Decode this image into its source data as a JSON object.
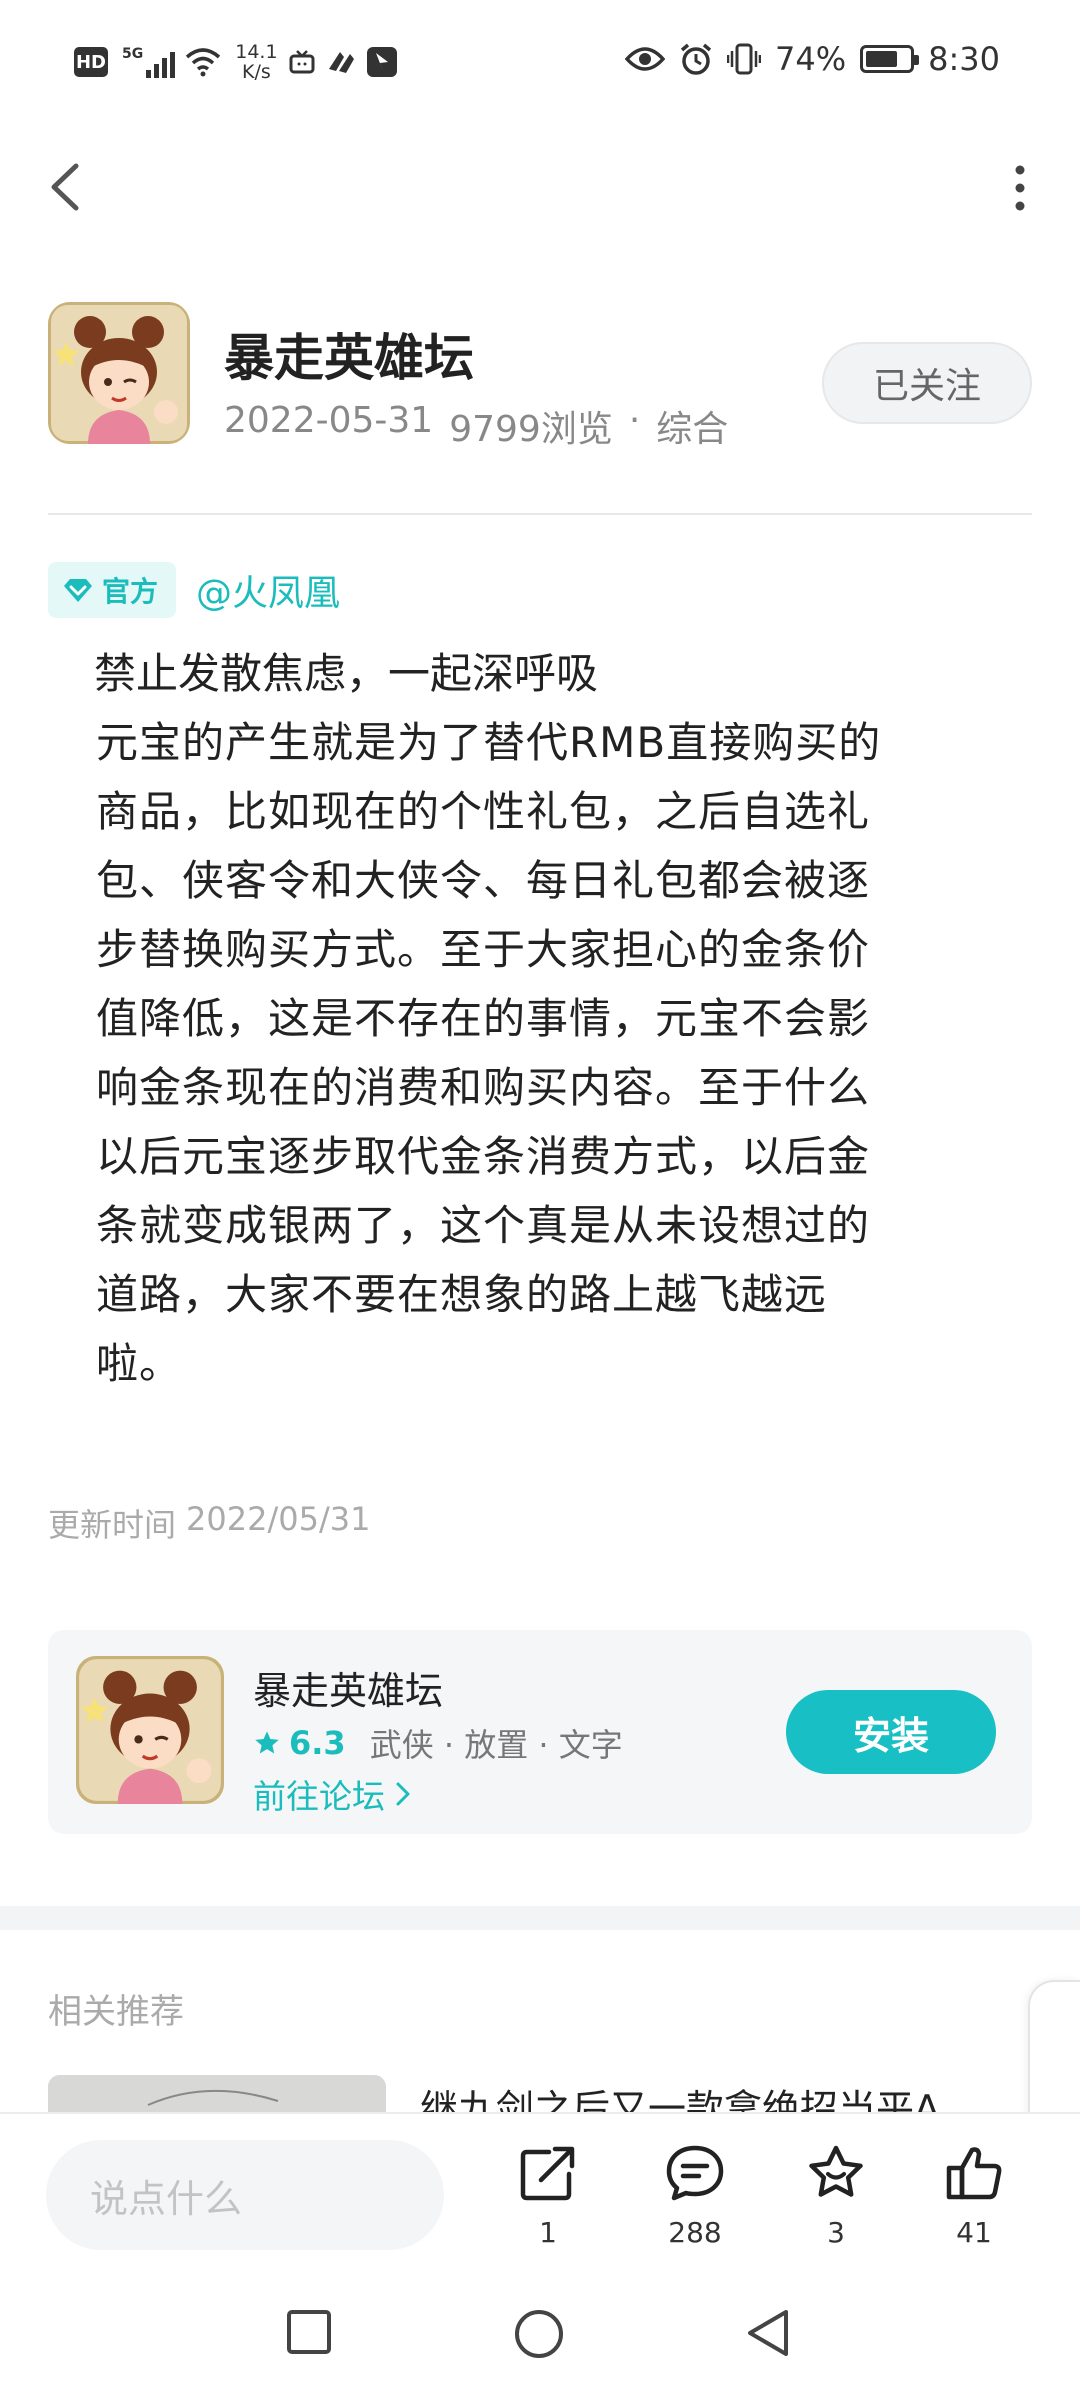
{
  "status_bar": {
    "hd": "HD",
    "network": "5G",
    "speed_value": "14.1",
    "speed_unit": "K/s",
    "battery_text": "74%",
    "battery_level": 0.74,
    "time": "8:30"
  },
  "header": {
    "forum_name": "暴走英雄坛",
    "date": "2022-05-31",
    "views": "9799浏览",
    "separator": "·",
    "category": "综合",
    "follow_label": "已关注"
  },
  "post": {
    "badge": "官方",
    "author": "@火凤凰",
    "title": "禁止发散焦虑，一起深呼吸",
    "body_lines": [
      "元宝的产生就是为了替代RMB直接购买的",
      "商品，比如现在的个性礼包，之后自选礼",
      "包、侠客令和大侠令、每日礼包都会被逐",
      "步替换购买方式。至于大家担心的金条价",
      "值降低，这是不存在的事情，元宝不会影",
      "响金条现在的消费和购买内容。至于什么",
      "以后元宝逐步取代金条消费方式，以后金",
      "条就变成银两了，这个真是从未设想过的",
      "道路，大家不要在想象的路上越飞越远",
      "啦。"
    ],
    "update_label": "更新时间",
    "update_date": "2022/05/31"
  },
  "game_card": {
    "name": "暴走英雄坛",
    "rating": "6.3",
    "tags": "武侠 · 放置 · 文字",
    "forum_link": "前往论坛",
    "install_label": "安装"
  },
  "related": {
    "heading": "相关推荐",
    "first_title": "继九剑之后又一款拿绝招当平A"
  },
  "bottom_bar": {
    "input_placeholder": "说点什么",
    "share_count": "1",
    "comment_count": "288",
    "favorite_count": "3",
    "like_count": "41"
  },
  "colors": {
    "accent": "#18bfc4",
    "accent_text": "#1bbcbc",
    "badge_bg": "#e5f8f8",
    "card_bg": "#f5f6f8"
  }
}
